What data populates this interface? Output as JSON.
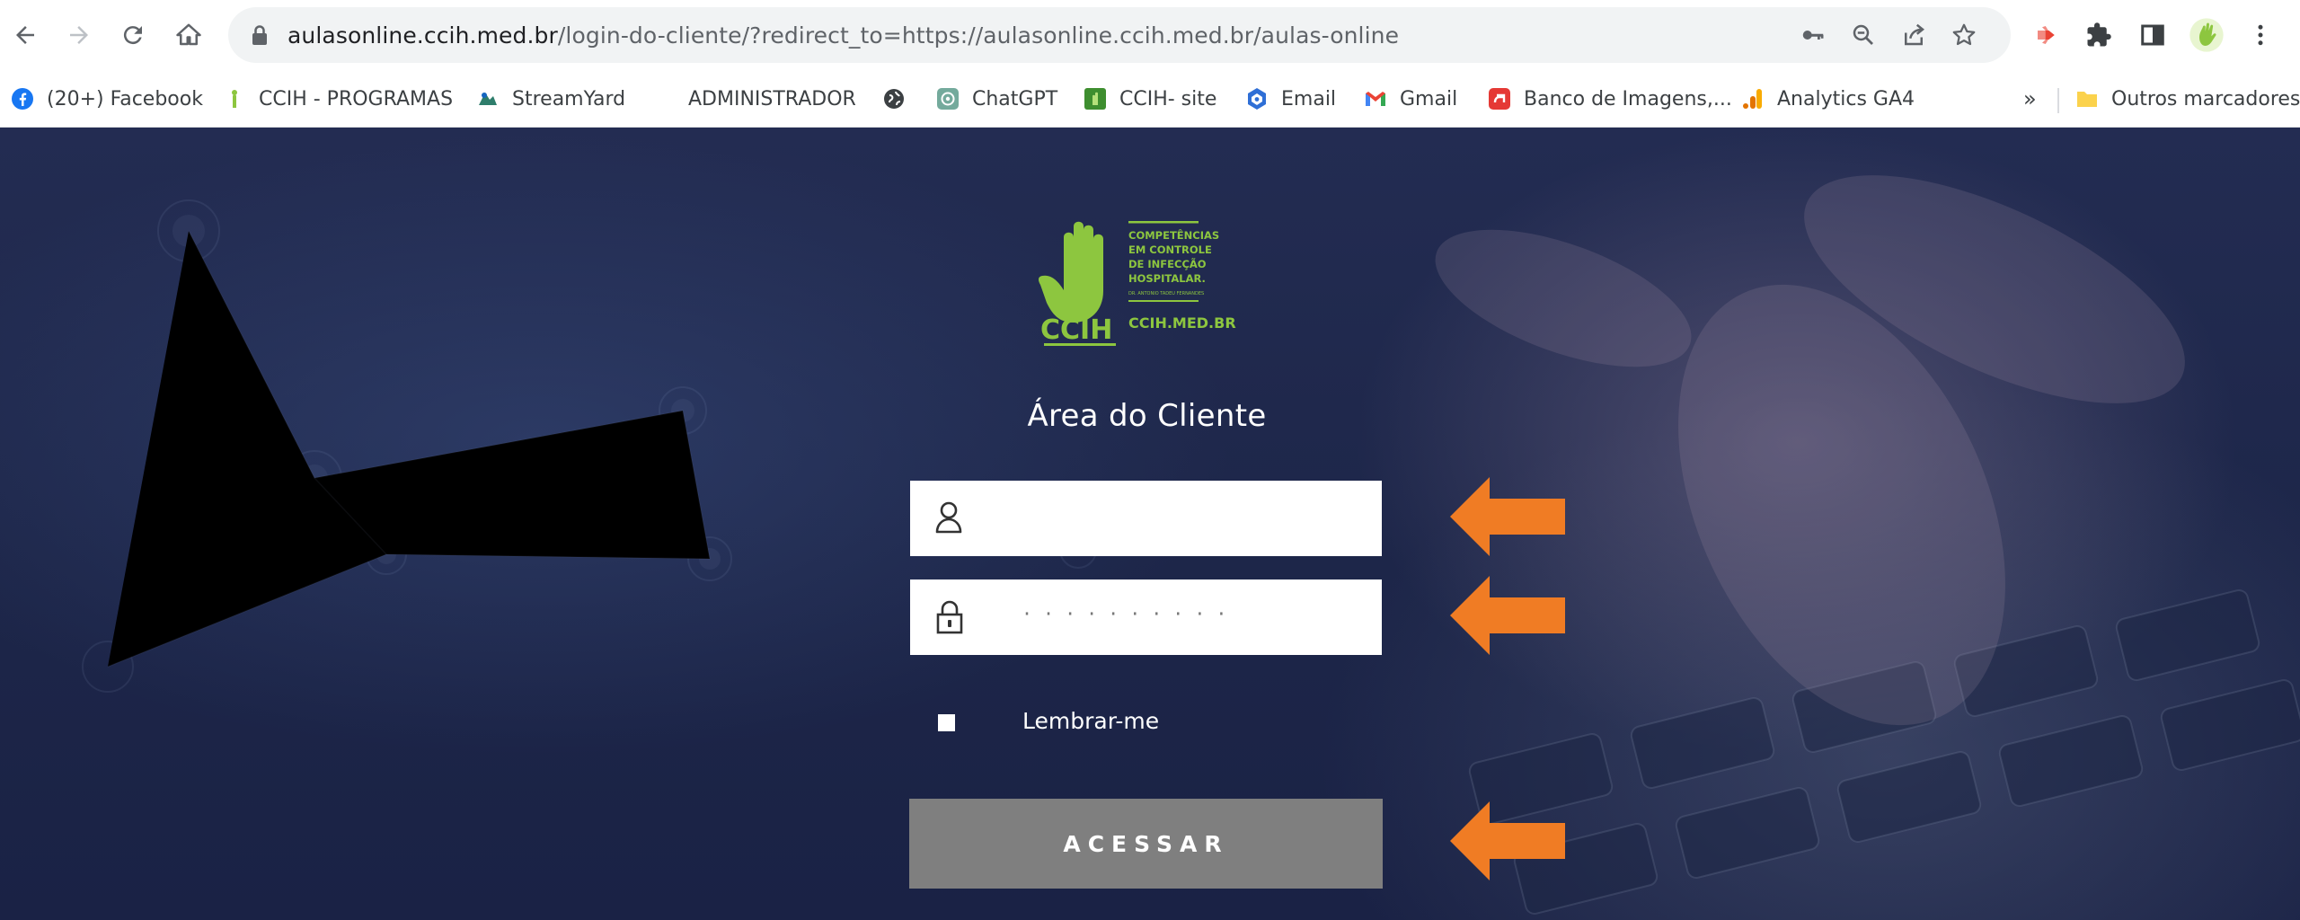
{
  "browser": {
    "url_host": "aulasonline.ccih.med.br",
    "url_path": "/login-do-cliente/?redirect_to=https://aulasonline.ccih.med.br/aulas-online",
    "icons": [
      "back-arrow-icon",
      "forward-arrow-icon",
      "reload-icon",
      "home-icon",
      "lock-icon",
      "key-icon",
      "zoom-icon",
      "share-icon",
      "star-icon",
      "extension-icon",
      "puzzle-icon",
      "side-panel-icon",
      "profile-icon",
      "more-menu-icon"
    ]
  },
  "bookmarks": {
    "items": [
      {
        "label": "(20+) Facebook",
        "icon": "facebook-icon"
      },
      {
        "label": "CCIH - PROGRAMAS",
        "icon": "ccih-icon"
      },
      {
        "label": "StreamYard",
        "icon": "streamyard-icon"
      },
      {
        "label": "ADMINISTRADOR",
        "icon": ""
      },
      {
        "label": "",
        "icon": "globe-icon"
      },
      {
        "label": "ChatGPT",
        "icon": "chatgpt-icon"
      },
      {
        "label": "CCIH- site",
        "icon": "ccih-site-icon"
      },
      {
        "label": "Email",
        "icon": "email-icon"
      },
      {
        "label": "Gmail",
        "icon": "gmail-icon"
      },
      {
        "label": "Banco de Imagens,...",
        "icon": "image-bank-icon"
      },
      {
        "label": "Analytics GA4",
        "icon": "analytics-icon"
      }
    ],
    "overflow": "»",
    "other_label": "Outros marcadores"
  },
  "logo": {
    "brand": "CCIH",
    "line1": "COMPETÊNCIAS",
    "line2": "EM CONTROLE",
    "line3": "DE INFECÇÃO",
    "line4": "HOSPITALAR.",
    "line5": "DR. ANTONIO TADEU FERNANDES",
    "site": "CCIH.MED.BR"
  },
  "login": {
    "title": "Área do Cliente",
    "username_value": "",
    "password_mask": "··········",
    "remember_label": "Lembrar-me",
    "submit_label": "ACESSAR"
  },
  "colors": {
    "accent_green": "#8dc63f",
    "arrow_orange": "#f07c24",
    "button_gray": "#7f7f7f",
    "background_navy": "#1c2447"
  }
}
